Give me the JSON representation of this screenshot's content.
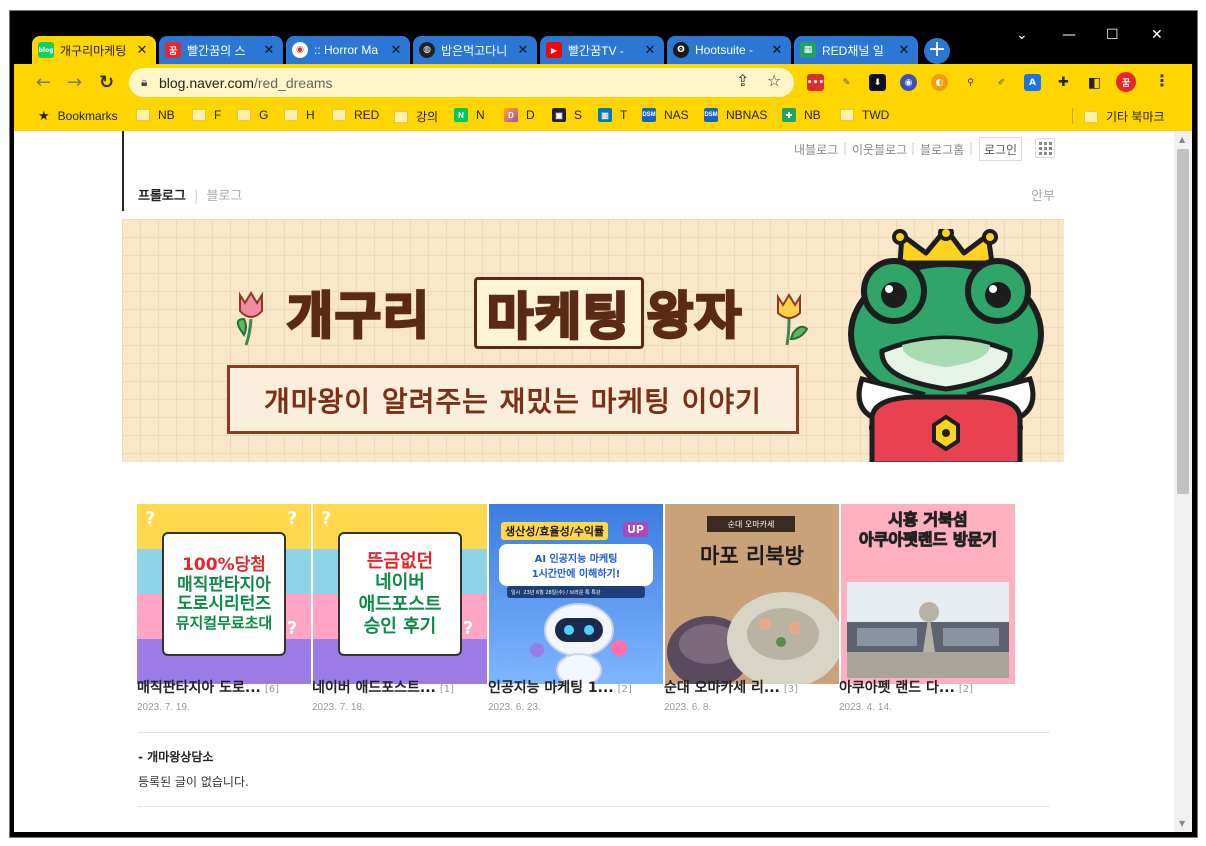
{
  "tabs": [
    {
      "title": "개구리마케팅",
      "favicon": "blog-favicon",
      "fav_text": "blog",
      "fav_color": "#19ce60",
      "active": true
    },
    {
      "title": "빨간꿈의 스",
      "favicon": "red-dream-favicon",
      "fav_text": "꿈",
      "fav_color": "#e8262d",
      "active": false
    },
    {
      "title": ":: Horror Ma",
      "favicon": "eye-favicon",
      "fav_text": "◉",
      "fav_color": "#ffffff",
      "active": false
    },
    {
      "title": "밥은먹고다니",
      "favicon": "globe-favicon",
      "fav_text": "◍",
      "fav_color": "#222222",
      "active": false
    },
    {
      "title": "빨간꿈TV -",
      "favicon": "youtube-favicon",
      "fav_text": "▶",
      "fav_color": "#ff0000",
      "active": false
    },
    {
      "title": "Hootsuite -",
      "favicon": "owl-favicon",
      "fav_text": "ʘ",
      "fav_color": "#1b1b1b",
      "active": false
    },
    {
      "title": "RED채널 일",
      "favicon": "sheets-favicon",
      "fav_text": "▦",
      "fav_color": "#1ea362",
      "active": false
    }
  ],
  "new_tab_label": "+",
  "window_controls": {
    "dropdown": "⌄",
    "minimize": "—",
    "maximize": "☐",
    "close": "✕"
  },
  "address": {
    "host": "blog.naver.com",
    "path": "/red_dreams"
  },
  "bookmarks": [
    {
      "label": "Bookmarks",
      "icon": "star-icon"
    },
    {
      "label": "NB",
      "icon": "folder-icon"
    },
    {
      "label": "F",
      "icon": "folder-icon"
    },
    {
      "label": "G",
      "icon": "folder-icon"
    },
    {
      "label": "H",
      "icon": "folder-icon"
    },
    {
      "label": "RED",
      "icon": "folder-icon"
    },
    {
      "label": "강의",
      "icon": "folder-icon"
    },
    {
      "label": "N",
      "icon": "naver-icon"
    },
    {
      "label": "D",
      "icon": "d-icon"
    },
    {
      "label": "S",
      "icon": "s-icon"
    },
    {
      "label": "T",
      "icon": "trello-icon"
    },
    {
      "label": "NAS",
      "icon": "dsm-icon"
    },
    {
      "label": "NBNAS",
      "icon": "dsm-icon"
    },
    {
      "label": "NB",
      "icon": "sheets-icon"
    },
    {
      "label": "TWD",
      "icon": "folder-icon"
    }
  ],
  "other_bookmarks": "기타 북마크",
  "blog": {
    "top_links": [
      "내블로그",
      "이웃블로그",
      "블로그홈"
    ],
    "login": "로그인",
    "nav_tabs": [
      "프롤로그",
      "블로그"
    ],
    "right_link": "안부",
    "banner_title": [
      "개구리",
      "마케팅",
      "왕자"
    ],
    "banner_subtitle": "개마왕이 알려주는 재밌는 마케팅 이야기",
    "posts": [
      {
        "title": "매직판타지아 도로...",
        "count": "[6]",
        "date": "2023. 7. 19.",
        "thumb_text": [
          "100%당첨",
          "매직판타지아",
          "도로시리턴즈",
          "뮤지컬무료초대"
        ]
      },
      {
        "title": "네이버 애드포스트...",
        "count": "[1]",
        "date": "2023. 7. 18.",
        "thumb_text": [
          "뜬금없던",
          "네이버",
          "애드포스트",
          "승인 후기"
        ]
      },
      {
        "title": "인공지능 마케팅 1...",
        "count": "[2]",
        "date": "2023. 6. 23.",
        "thumb_text": [
          "생산성/효율성/수익률",
          "UP",
          "AI 인공지능 마케팅",
          "1시간만에 이해하기!",
          "일시",
          "23년 6월 28일(수) / 브라운 톡 특강"
        ]
      },
      {
        "title": "순대 오마카세 리...",
        "count": "[3]",
        "date": "2023. 6. 8.",
        "thumb_text": [
          "순대 오마카세",
          "마포 리북방"
        ]
      },
      {
        "title": "아쿠아펫 랜드 다...",
        "count": "[2]",
        "date": "2023. 4. 14.",
        "thumb_text": [
          "시흥 거북섬",
          "아쿠아펫랜드 방문기"
        ]
      }
    ],
    "section_title": "- 개마왕상담소",
    "section_empty": "등록된 글이 없습니다."
  },
  "colors": {
    "chrome_yellow": "#ffd500",
    "tab_blue": "#2d77d4",
    "banner_bg": "#f8e7c9",
    "title_green": "#0b8a48"
  }
}
